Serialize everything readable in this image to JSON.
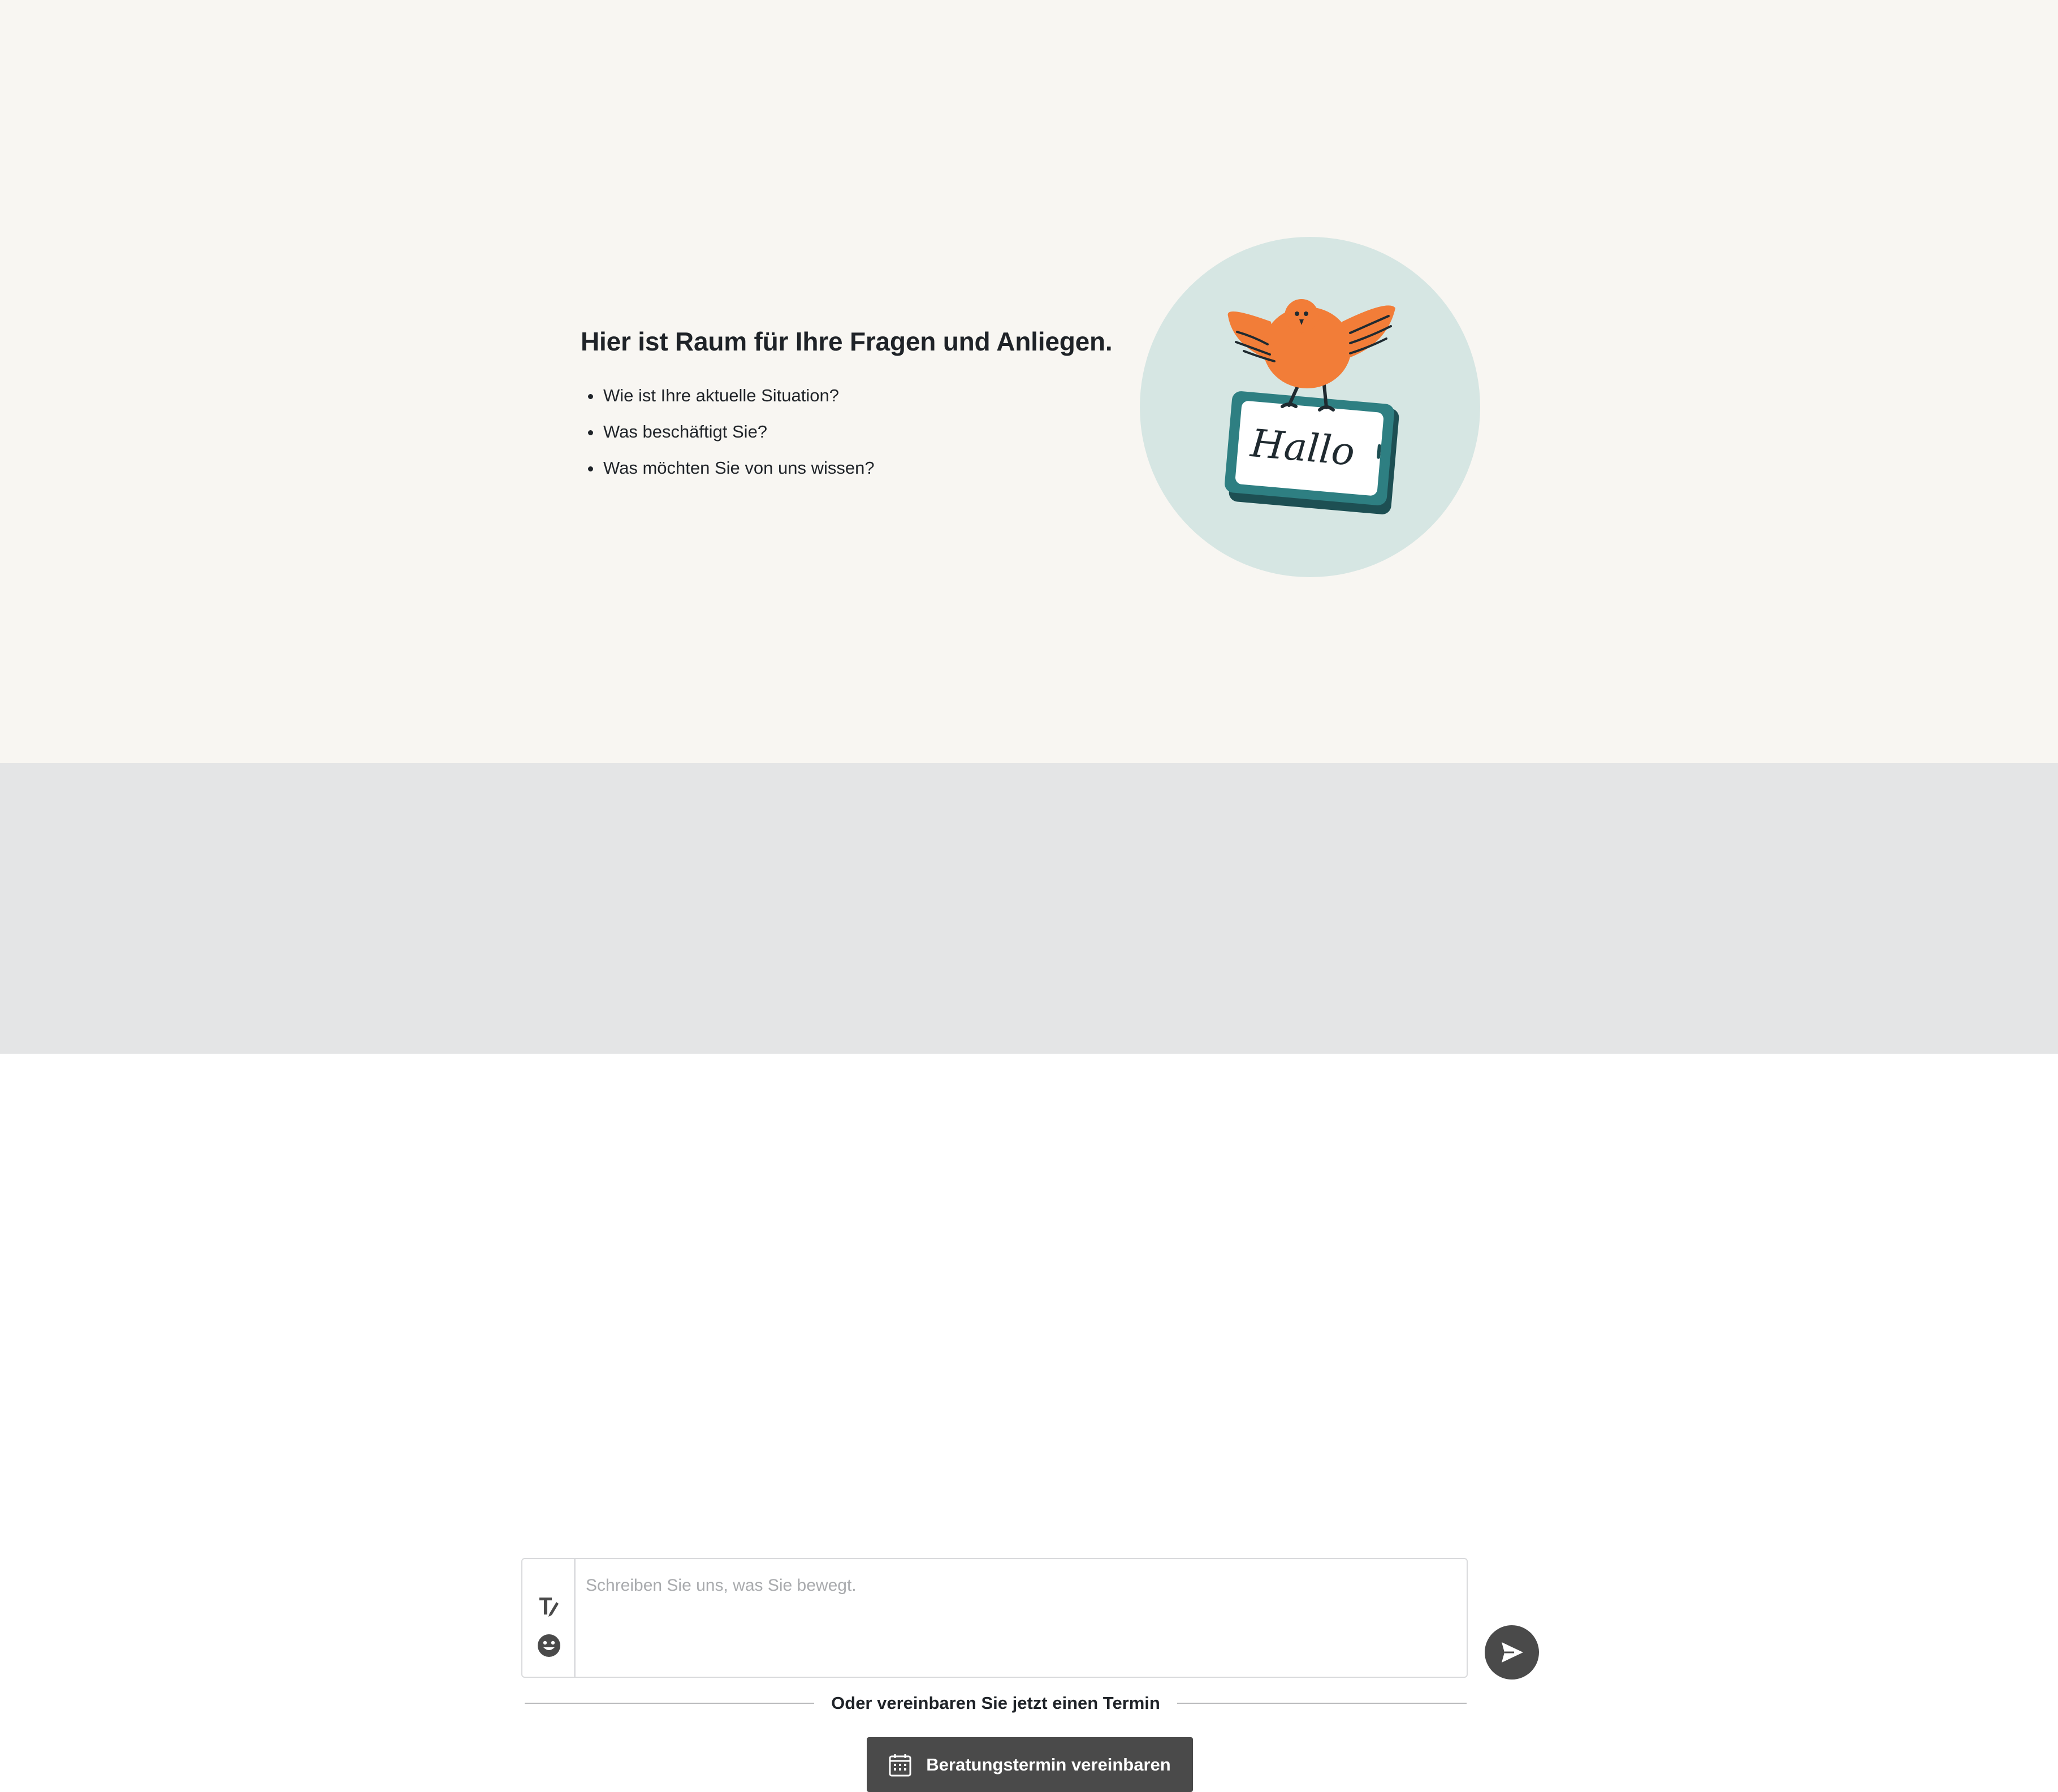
{
  "intro": {
    "headline": "Hier ist Raum für Ihre Fragen und Anliegen.",
    "questions": [
      "Wie ist Ihre aktuelle Situation?",
      "Was beschäftigt Sie?",
      "Was möchten Sie von uns wissen?"
    ]
  },
  "illustration": {
    "sign_text": "Hallo"
  },
  "composer": {
    "placeholder": "Schreiben Sie uns, was Sie bewegt.",
    "format_icon": "text-format-icon",
    "emoji_icon": "emoji-icon",
    "send_icon": "send-icon"
  },
  "appointment": {
    "divider_label": "Oder vereinbaren Sie jetzt einen Termin",
    "button_label": "Beratungstermin vereinbaren",
    "button_icon": "calendar-icon"
  },
  "colors": {
    "page_background": "#f8f6f2",
    "footer_background": "#e4e5e6",
    "button_dark": "#4a4a4a",
    "bird_orange": "#f27d38",
    "sign_teal": "#2e6f73",
    "circle_mint": "#d6e6e3"
  }
}
